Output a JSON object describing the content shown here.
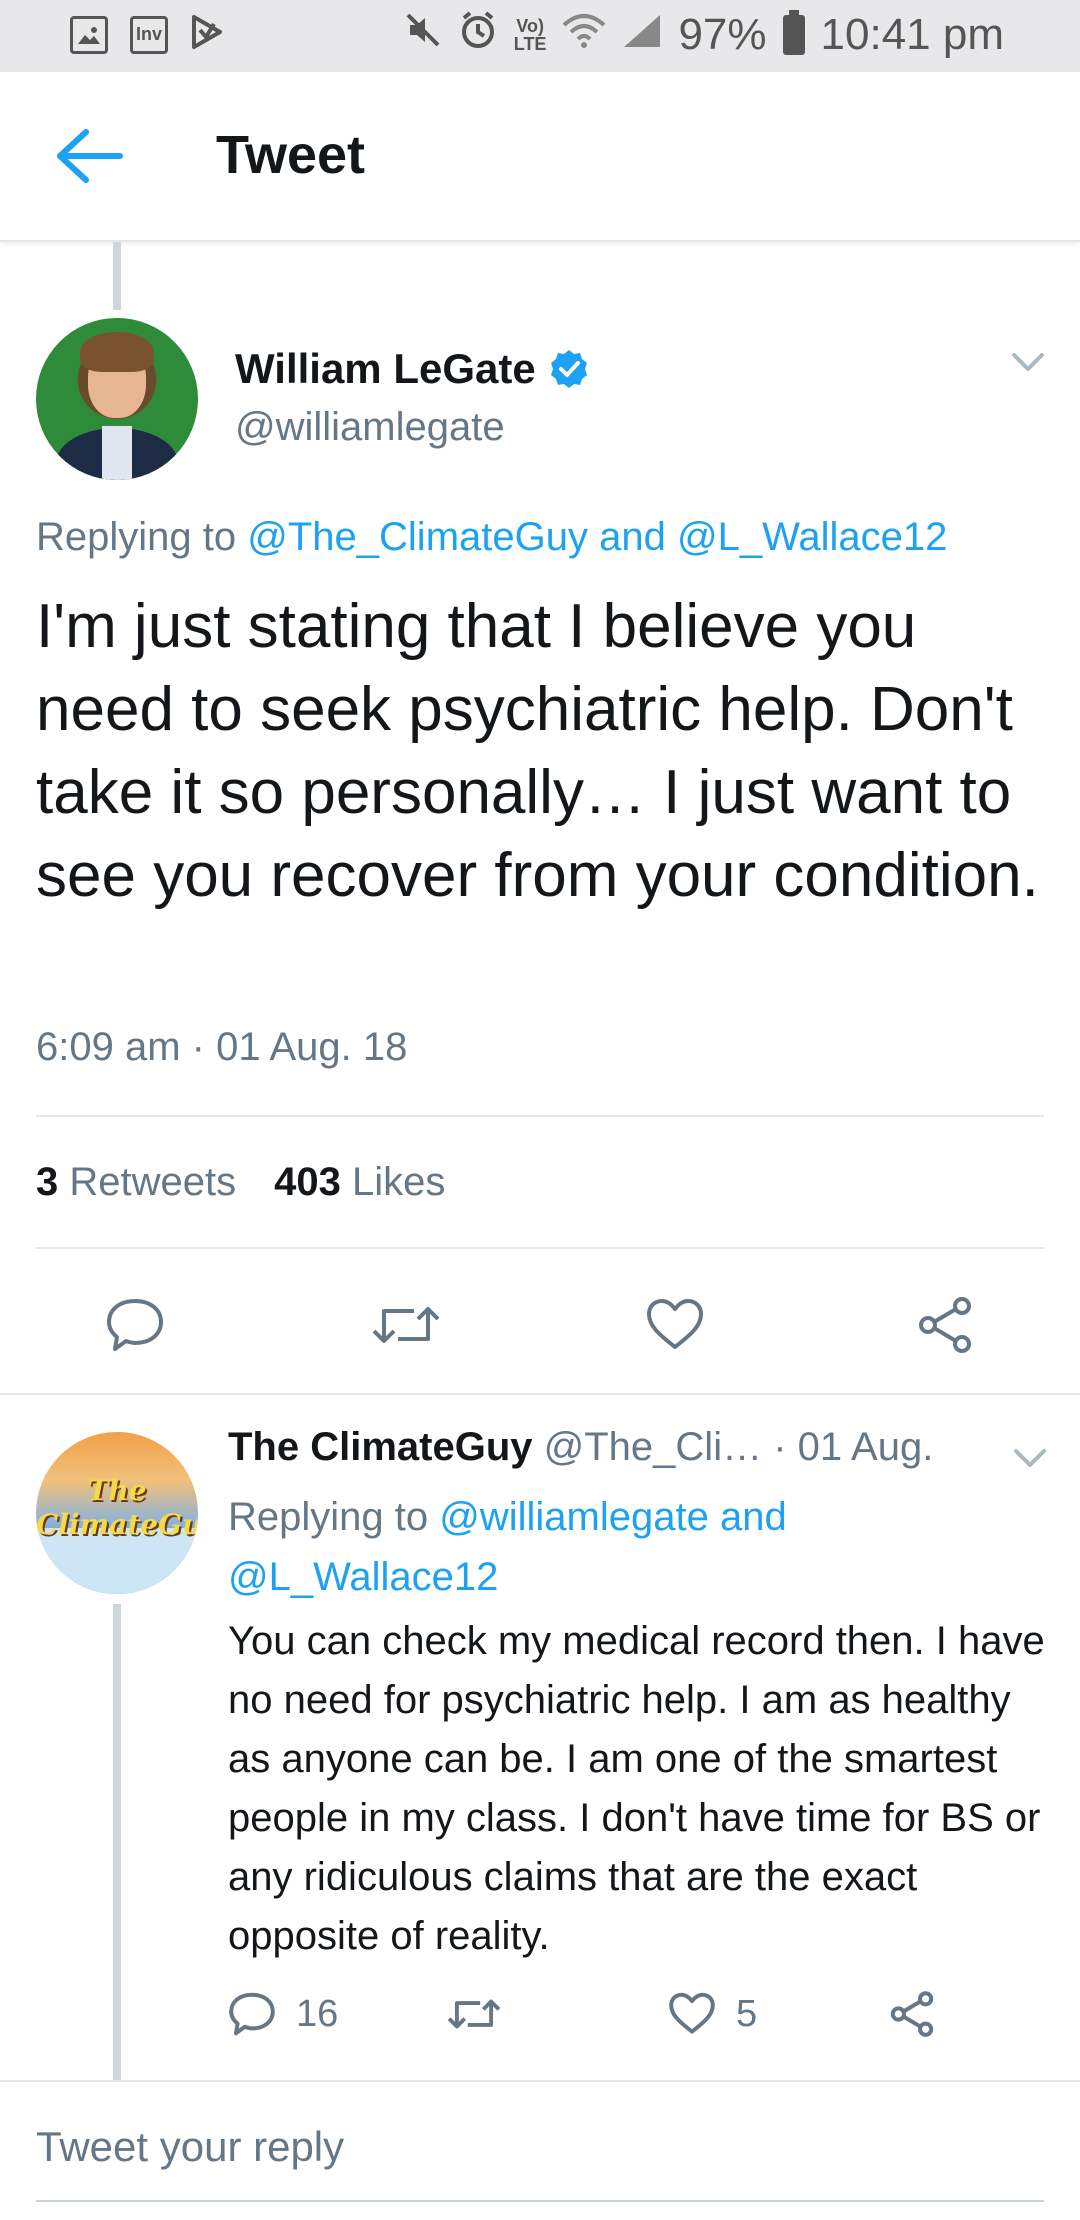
{
  "status_bar": {
    "battery": "97%",
    "time": "10:41 pm",
    "icons": [
      "image-icon",
      "inv-icon",
      "play-store-icon",
      "mute-icon",
      "alarm-icon",
      "volte-icon",
      "wifi-icon",
      "signal-icon",
      "battery-icon"
    ],
    "inv_label": "Inv"
  },
  "header": {
    "title": "Tweet"
  },
  "main_tweet": {
    "author_name": "William LeGate",
    "author_handle": "@williamlegate",
    "replying_prefix": "Replying to",
    "reply_to_1": "@The_ClimateGuy",
    "reply_and": "and",
    "reply_to_2": "@L_Wallace12",
    "text": "I'm just stating that I believe you need to seek psychiatric help. Don't take it so personally… I just want to see you recover from your condition.",
    "timestamp": "6:09 am · 01 Aug. 18",
    "retweets_count": "3",
    "retweets_label": "Retweets",
    "likes_count": "403",
    "likes_label": "Likes"
  },
  "reply_tweet": {
    "author_name": "The ClimateGuy",
    "author_handle": "@The_Cli…",
    "date": "· 01 Aug.",
    "avatar_text_1": "The",
    "avatar_text_2": "ClimateGuy",
    "replying_prefix": "Replying to",
    "reply_to_1": "@williamlegate",
    "reply_and": "and",
    "reply_to_2": "@L_Wallace12",
    "text": "You can check my medical record then. I have no need for psychiatric help. I am as healthy as anyone can be. I am one of the smartest people in my class. I don't have time for BS or any ridiculous claims that are the exact opposite of reality.",
    "replies_count": "16",
    "likes_count": "5"
  },
  "compose": {
    "placeholder": "Tweet your reply"
  },
  "colors": {
    "accent": "#1da1f2",
    "text": "#14171a",
    "muted": "#657786",
    "divider": "#e1e8ed"
  }
}
